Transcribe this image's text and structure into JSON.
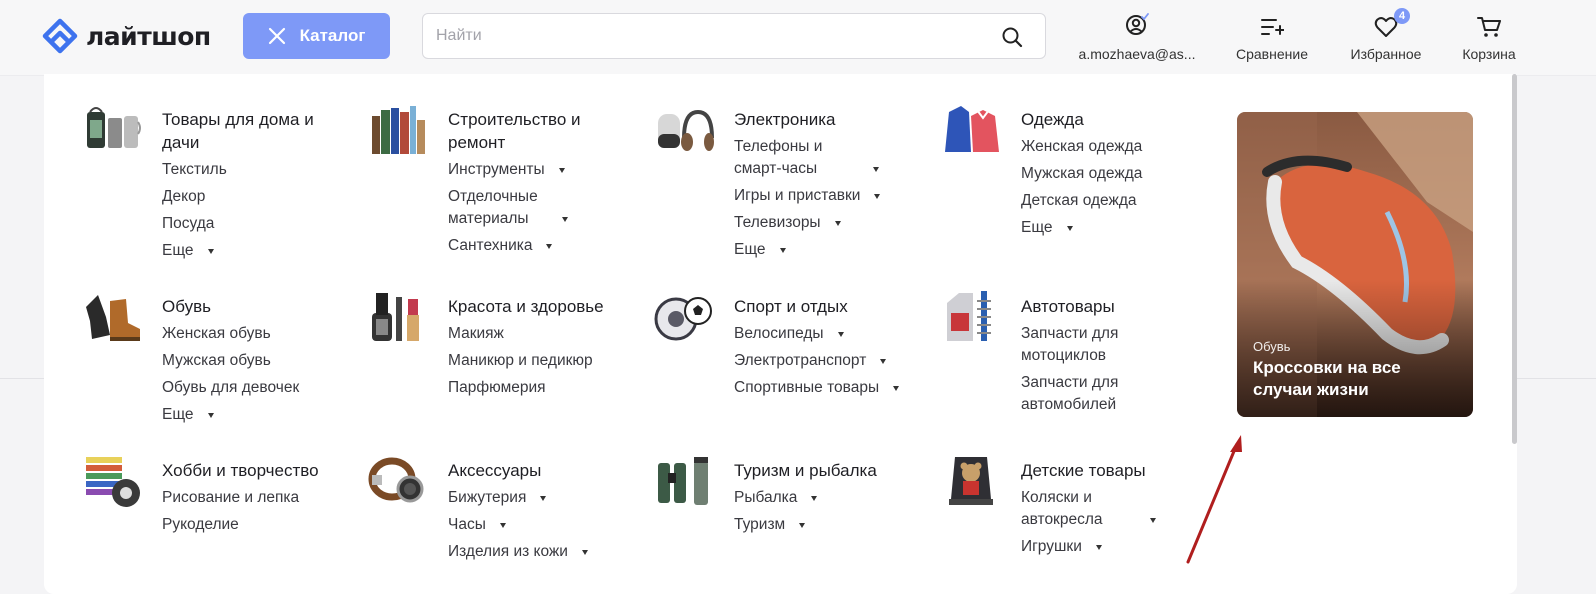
{
  "header": {
    "logo_text": "лайтшоп",
    "catalog_label": "Каталог",
    "search_placeholder": "Найти",
    "account_label": "a.mozhaeva@as...",
    "compare_label": "Сравнение",
    "favorites_label": "Избранное",
    "favorites_count": "4",
    "cart_label": "Корзина",
    "accent_color": "#7e99f7"
  },
  "categories": [
    {
      "title": "Товары для дома и дачи",
      "icon": "lanterns-kettle-icon",
      "items": [
        {
          "label": "Текстиль",
          "has_sub": false
        },
        {
          "label": "Декор",
          "has_sub": false
        },
        {
          "label": "Посуда",
          "has_sub": false
        },
        {
          "label": "Еще",
          "has_sub": true
        }
      ]
    },
    {
      "title": "Строительство и ремонт",
      "icon": "paint-rollers-icon",
      "items": [
        {
          "label": "Инструменты",
          "has_sub": true
        },
        {
          "label": "Отделочные материалы",
          "has_sub": true
        },
        {
          "label": "Сантехника",
          "has_sub": true
        }
      ]
    },
    {
      "title": "Электроника",
      "icon": "speaker-headphones-icon",
      "items": [
        {
          "label": "Телефоны и смарт-часы",
          "has_sub": true
        },
        {
          "label": "Игры и приставки",
          "has_sub": true
        },
        {
          "label": "Телевизоры",
          "has_sub": true
        },
        {
          "label": "Еще",
          "has_sub": true
        }
      ]
    },
    {
      "title": "Одежда",
      "icon": "jackets-icon",
      "items": [
        {
          "label": "Женская одежда",
          "has_sub": false
        },
        {
          "label": "Мужская одежда",
          "has_sub": false
        },
        {
          "label": "Детская одежда",
          "has_sub": false
        },
        {
          "label": "Еще",
          "has_sub": true
        }
      ]
    },
    {
      "title": "Обувь",
      "icon": "boots-icon",
      "items": [
        {
          "label": "Женская обувь",
          "has_sub": false
        },
        {
          "label": "Мужская обувь",
          "has_sub": false
        },
        {
          "label": "Обувь для девочек",
          "has_sub": false
        },
        {
          "label": "Еще",
          "has_sub": true
        }
      ]
    },
    {
      "title": "Красота и здоровье",
      "icon": "cosmetics-icon",
      "items": [
        {
          "label": "Макияж",
          "has_sub": false
        },
        {
          "label": "Маникюр и педикюр",
          "has_sub": false
        },
        {
          "label": "Парфюмерия",
          "has_sub": false
        }
      ]
    },
    {
      "title": "Спорт и отдых",
      "icon": "ball-wheel-icon",
      "items": [
        {
          "label": "Велосипеды",
          "has_sub": true
        },
        {
          "label": "Электротранспорт",
          "has_sub": true
        },
        {
          "label": "Спортивные товары",
          "has_sub": true
        }
      ]
    },
    {
      "title": "Автотовары",
      "icon": "oil-canister-icon",
      "items": [
        {
          "label": "Запчасти для мотоциклов",
          "has_sub": false
        },
        {
          "label": "Запчасти для автомобилей",
          "has_sub": false
        }
      ]
    },
    {
      "title": "Хобби и творчество",
      "icon": "pencils-tape-icon",
      "items": [
        {
          "label": "Рисование и лепка",
          "has_sub": false
        },
        {
          "label": "Рукоделие",
          "has_sub": false
        }
      ]
    },
    {
      "title": "Аксессуары",
      "icon": "belt-watch-icon",
      "items": [
        {
          "label": "Бижутерия",
          "has_sub": true
        },
        {
          "label": "Часы",
          "has_sub": true
        },
        {
          "label": "Изделия из кожи",
          "has_sub": true
        }
      ]
    },
    {
      "title": "Туризм и рыбалка",
      "icon": "binoculars-thermos-icon",
      "items": [
        {
          "label": "Рыбалка",
          "has_sub": true
        },
        {
          "label": "Туризм",
          "has_sub": true
        }
      ]
    },
    {
      "title": "Детские товары",
      "icon": "car-seat-icon",
      "items": [
        {
          "label": "Коляски и автокресла",
          "has_sub": true
        },
        {
          "label": "Игрушки",
          "has_sub": true
        }
      ]
    }
  ],
  "promo": {
    "category": "Обувь",
    "title": "Кроссовки на все случаи жизни"
  }
}
